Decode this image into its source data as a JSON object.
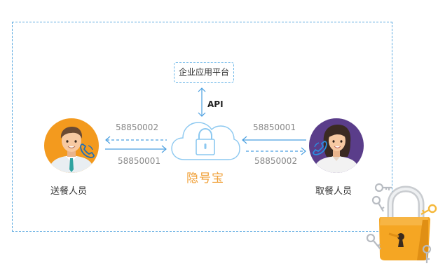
{
  "diagram": {
    "platform_label": "企业应用平台",
    "api_label": "API",
    "center_label": "隐号宝",
    "left_person_label": "送餐人员",
    "right_person_label": "取餐人员",
    "left_numbers": {
      "upper": "58850002",
      "lower": "58850001"
    },
    "right_numbers": {
      "upper": "58850001",
      "lower": "58850002"
    }
  },
  "colors": {
    "frame": "#5aa9e0",
    "arrow": "#4a9fe0",
    "cloud": "#8cc8f0",
    "accent": "#f0a13a",
    "delivery_bg": "#f39a1e",
    "pickup_bg": "#5a3d8a",
    "lock": "#f5a623"
  },
  "icons": {
    "cloud": "cloud-lock-icon",
    "delivery": "delivery-person-avatar",
    "pickup": "pickup-person-avatar",
    "padlock": "padlock-with-keys-decoration"
  }
}
